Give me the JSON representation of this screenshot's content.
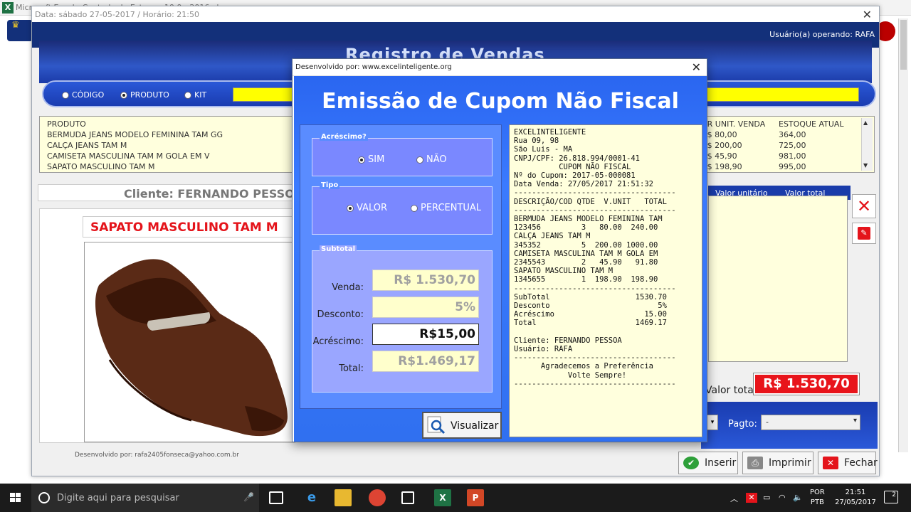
{
  "excel": {
    "title": "Microsoft Excel - Controle de Estoque 10.0 - 2016.xlsm",
    "icon": "excel-icon"
  },
  "main": {
    "title": "Data: sábado 27-05-2017 / Horário: 21:50",
    "user_label": "Usuário(a) operando: RAFA",
    "banner_title": "Registro de Vendas",
    "options": {
      "codigo": "CÓDIGO",
      "produto": "PRODUTO",
      "kit": "KIT"
    },
    "list": {
      "header_produto": "PRODUTO",
      "header_valor": "VLR UNIT. VENDA",
      "header_estoque": "ESTOQUE ATUAL",
      "rows": [
        {
          "produto": "BERMUDA JEANS MODELO FEMININA TAM GG",
          "valor": "R$ 80,00",
          "estoque": "364,00"
        },
        {
          "produto": "CALÇA JEANS TAM M",
          "valor": "R$ 200,00",
          "estoque": "725,00"
        },
        {
          "produto": "CAMISETA MASCULINA TAM M GOLA EM V",
          "valor": "R$ 45,90",
          "estoque": "981,00"
        },
        {
          "produto": "SAPATO MASCULINO TAM M",
          "valor": "R$ 198,90",
          "estoque": "995,00"
        }
      ]
    },
    "cliente": "Cliente: FERNANDO PESSOA",
    "product_name": "SAPATO MASCULINO TAM M",
    "dev_footer": "Desenvolvido por: rafa2405fonseca@yahoo.com.br",
    "items_header": {
      "valor_unitario": "Valor unitário",
      "valor_total": "Valor total"
    },
    "valor_total_label": "Valor total",
    "valor_total_value": "R$ 1.530,70",
    "pagto_label": "Pagto:",
    "pagto_value": "-",
    "buttons": {
      "inserir": "Inserir",
      "imprimir": "Imprimir",
      "fechar": "Fechar"
    },
    "side_text": "re"
  },
  "dialog": {
    "title": "Desenvolvido por: www.excelinteligente.org",
    "heading": "Emissão de Cupom Não Fiscal",
    "acrescimo": {
      "legend": "Acréscimo?",
      "sim": "SIM",
      "nao": "NÃO",
      "selected": "SIM"
    },
    "tipo": {
      "legend": "Tipo",
      "valor": "VALOR",
      "percentual": "PERCENTUAL",
      "selected": "VALOR"
    },
    "subtotal": {
      "legend": "Subtotal",
      "venda_label": "Venda:",
      "venda_value": "R$ 1.530,70",
      "desconto_label": "Desconto:",
      "desconto_value": "5%",
      "acrescimo_label": "Acréscimo:",
      "acrescimo_value": "R$15,00",
      "total_label": "Total:",
      "total_value": "R$1.469,17"
    },
    "receipt": "EXCELINTELIGENTE\nRua 09, 98\nSão Luis - MA\nCNPJ/CPF: 26.818.994/0001-41\n          CUPOM NÃO FISCAL\nNº do Cupom: 2017-05-000081\nData Venda: 27/05/2017 21:51:32\n------------------------------------\nDESCRIÇÃO/COD QTDE  V.UNIT   TOTAL\n------------------------------------\nBERMUDA JEANS MODELO FEMININA TAM\n123456         3   80.00  240.00\nCALÇA JEANS TAM M\n345352         5  200.00 1000.00\nCAMISETA MASCULINA TAM M GOLA EM\n2345543        2   45.90   91.80\nSAPATO MASCULINO TAM M\n1345655        1  198.90  198.90\n------------------------------------\nSubTotal                   1530.70\nDesconto                        5%\nAcréscimo                    15.00\nTotal                      1469.17\n\nCliente: FERNANDO PESSOA\nUsuário: RAFA\n------------------------------------\n      Agradecemos a Preferência\n            Volte Sempre!\n------------------------------------",
    "visualizar": "Visualizar"
  },
  "taskbar": {
    "search_placeholder": "Digite aqui para pesquisar",
    "lang_top": "POR",
    "lang_bottom": "PTB",
    "time": "21:51",
    "date": "27/05/2017",
    "notifications": "2"
  },
  "colors": {
    "accent_blue": "#2a66f0",
    "total_red": "#e8141b",
    "banner_blue": "#13307a",
    "field_yellow": "#ffffcc"
  }
}
